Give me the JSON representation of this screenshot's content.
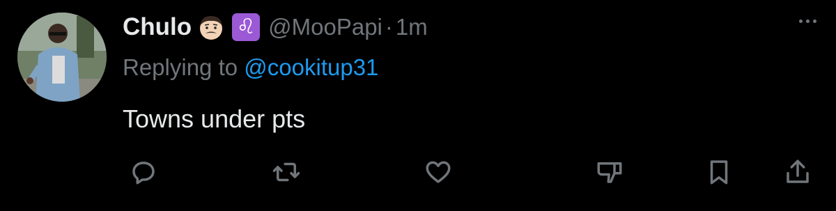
{
  "tweet": {
    "display_name": "Chulo",
    "name_emoji": "man-with-mustache-emoji",
    "zodiac_symbol": "♌",
    "handle": "@MooPapi",
    "separator": "·",
    "time_ago": "1m",
    "reply_prefix": "Replying to",
    "reply_to": "@cookitup31",
    "text": "Towns under pts"
  },
  "actions": [
    {
      "name": "reply",
      "icon": "reply-icon"
    },
    {
      "name": "retweet",
      "icon": "retweet-icon"
    },
    {
      "name": "like",
      "icon": "heart-icon"
    },
    {
      "name": "dislike",
      "icon": "thumbs-down-icon"
    },
    {
      "name": "bookmark",
      "icon": "bookmark-icon"
    },
    {
      "name": "share",
      "icon": "share-icon"
    }
  ],
  "colors": {
    "background": "#000000",
    "primary_text": "#e7e9ea",
    "secondary_text": "#71767b",
    "link": "#1d9bf0",
    "zodiac_bg": "#9b59d6"
  }
}
